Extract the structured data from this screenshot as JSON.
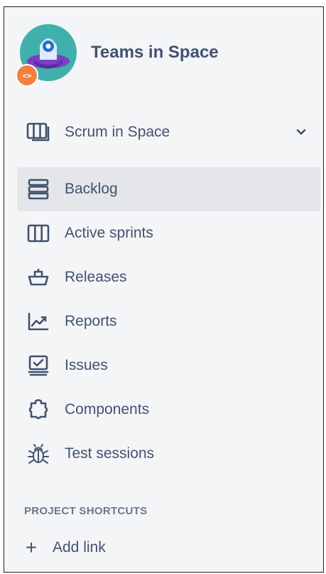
{
  "project": {
    "name": "Teams in Space",
    "avatar_icon": "ufo-avatar-icon",
    "badge_icon": "code-icon",
    "badge_text": "<>"
  },
  "board": {
    "label": "Scrum in Space",
    "icon": "board-icon",
    "chevron_icon": "chevron-down-icon"
  },
  "nav": {
    "items": [
      {
        "label": "Backlog",
        "icon": "backlog-icon",
        "active": true
      },
      {
        "label": "Active sprints",
        "icon": "active-sprints-icon",
        "active": false
      },
      {
        "label": "Releases",
        "icon": "releases-icon",
        "active": false
      },
      {
        "label": "Reports",
        "icon": "reports-icon",
        "active": false
      },
      {
        "label": "Issues",
        "icon": "issues-icon",
        "active": false
      },
      {
        "label": "Components",
        "icon": "components-icon",
        "active": false
      },
      {
        "label": "Test sessions",
        "icon": "bug-icon",
        "active": false
      }
    ]
  },
  "shortcuts": {
    "title": "PROJECT SHORTCUTS",
    "add_label": "Add link",
    "add_icon": "plus-icon"
  },
  "colors": {
    "sidebar_bg": "#f4f5f7",
    "text": "#42526e",
    "active_bg": "#e4e6ea",
    "muted": "#6b778c",
    "badge": "#f57f3d",
    "avatar_bg": "#3fb1ac"
  }
}
